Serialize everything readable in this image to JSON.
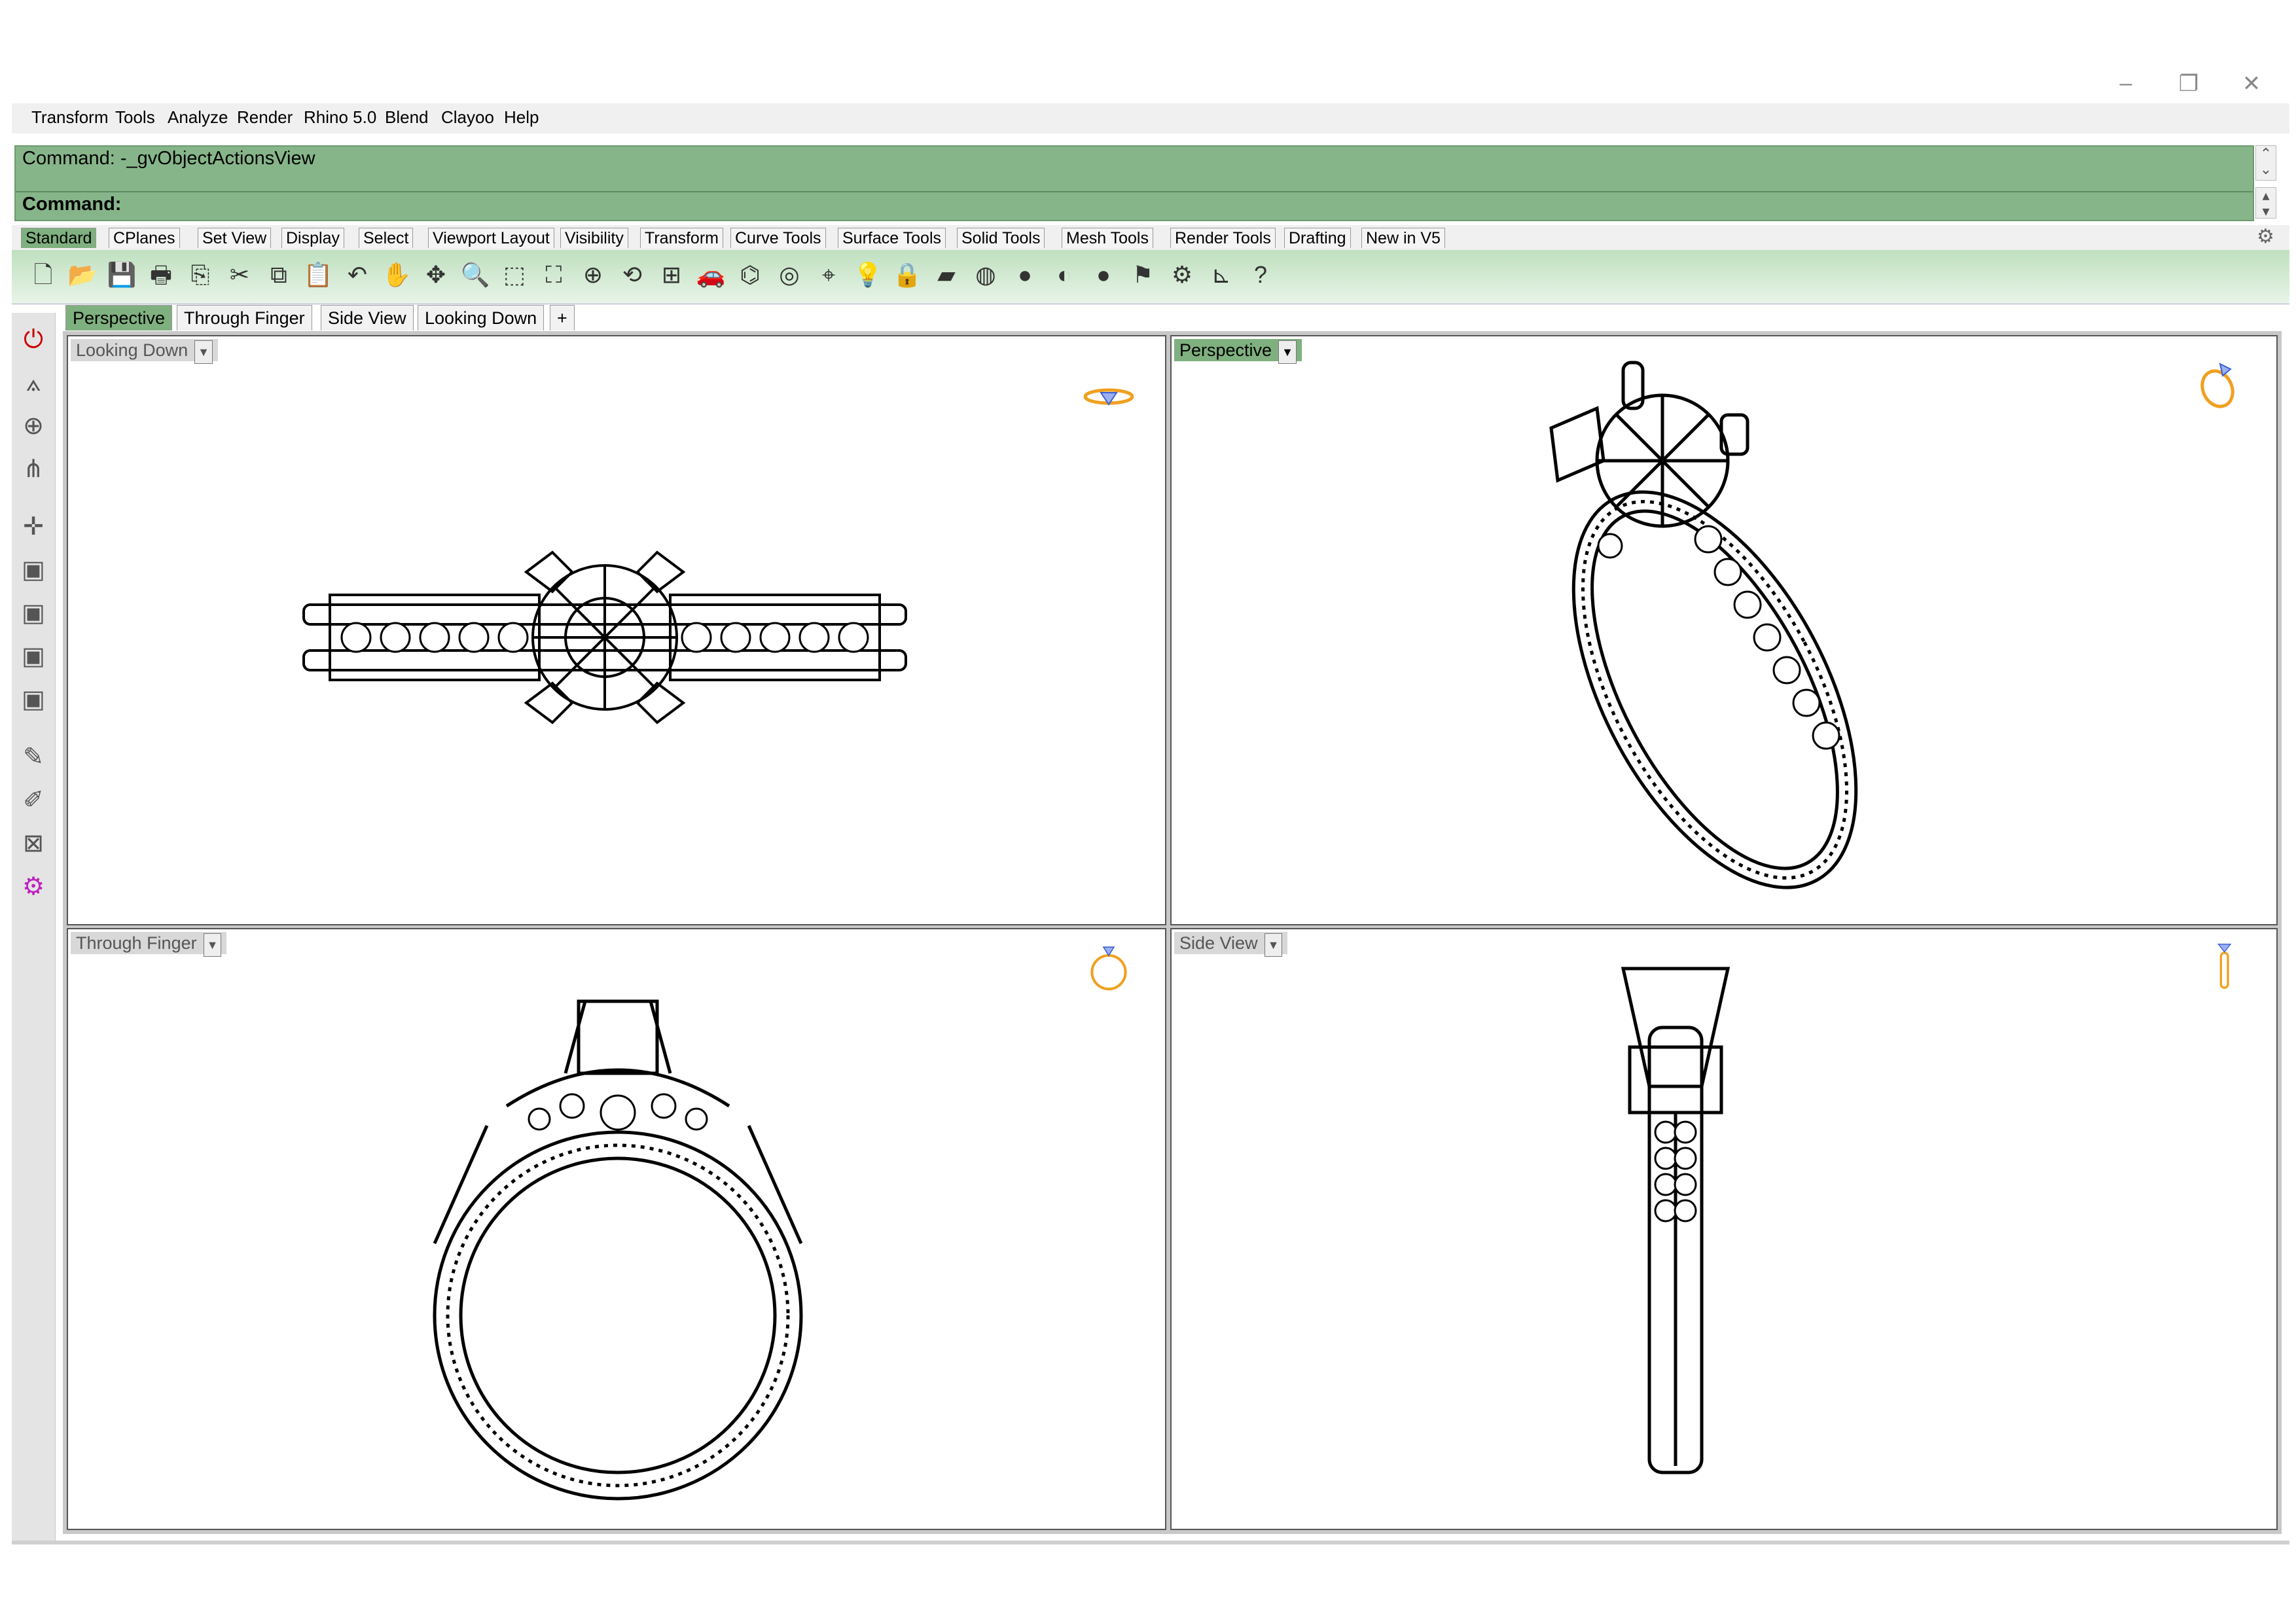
{
  "window": {
    "controls": {
      "minimize": "–",
      "restore": "❐",
      "close": "✕"
    }
  },
  "menubar": {
    "items": [
      "Transform",
      "Tools",
      "Analyze",
      "Render",
      "Rhino 5.0",
      "Blend",
      "Clayoo",
      "Help"
    ]
  },
  "command": {
    "history": "Command: -_gvObjectActionsView",
    "prompt": "Command:"
  },
  "toolbar_tabs": {
    "items": [
      "Standard",
      "CPlanes",
      "Set View",
      "Display",
      "Select",
      "Viewport Layout",
      "Visibility",
      "Transform",
      "Curve Tools",
      "Surface Tools",
      "Solid Tools",
      "Mesh Tools",
      "Render Tools",
      "Drafting",
      "New in V5"
    ],
    "active": "Standard"
  },
  "toolbar": {
    "icons": [
      "new-file-icon",
      "open-file-icon",
      "save-icon",
      "print-icon",
      "import-icon",
      "cut-icon",
      "copy-icon",
      "paste-icon",
      "undo-icon",
      "pan-hand-icon",
      "move-view-icon",
      "zoom-icon",
      "zoom-window-icon",
      "zoom-extents-icon",
      "zoom-selected-icon",
      "rotate-view-icon",
      "four-viewports-icon",
      "car-icon",
      "lamp-icon",
      "circle-icon",
      "snap-icon",
      "bulb-icon",
      "lock-icon",
      "layers-icon",
      "color-wheel-icon",
      "shaded-sphere-icon",
      "rendered-sphere-icon",
      "blue-sphere-icon",
      "flag-icon",
      "gear-settings-icon",
      "dimension-icon",
      "help-icon"
    ],
    "glyphs": [
      "🗋",
      "📂",
      "💾",
      "🖶",
      "⎘",
      "✂",
      "⧉",
      "📋",
      "↶",
      "✋",
      "✥",
      "🔍",
      "⬚",
      "⛶",
      "⊕",
      "⟲",
      "⊞",
      "🚗",
      "⌬",
      "◎",
      "⌖",
      "💡",
      "🔒",
      "▰",
      "◍",
      "●",
      "◐",
      "●",
      "⚑",
      "⚙",
      "⊾",
      "?"
    ]
  },
  "left_tools": {
    "icons": [
      "stop-icon",
      "plane-icon",
      "globe-icon",
      "triangle-nodes-icon",
      "axes-icon",
      "box-icon-1",
      "box-icon-2",
      "box-icon-3",
      "box-icon-4",
      "pen-icon",
      "brush-icon",
      "cancel-box-icon",
      "purple-gear-icon"
    ],
    "glyphs": [
      "⏻",
      "⟑",
      "⊕",
      "⋔",
      "✛",
      "▣",
      "▣",
      "▣",
      "▣",
      "✎",
      "✐",
      "⊠",
      "⚙"
    ]
  },
  "viewport_tabs": {
    "items": [
      "Perspective",
      "Through Finger",
      "Side View",
      "Looking Down"
    ],
    "active": "Perspective",
    "add_label": "+"
  },
  "viewports": [
    {
      "title": "Looking Down",
      "active": false,
      "gumball": "ring-top-gumball-icon"
    },
    {
      "title": "Perspective",
      "active": true,
      "gumball": "ring-perspective-gumball-icon"
    },
    {
      "title": "Through Finger",
      "active": false,
      "gumball": "ring-front-gumball-icon"
    },
    {
      "title": "Side View",
      "active": false,
      "gumball": "ring-side-gumball-icon"
    }
  ],
  "colors": {
    "command_bg": "#87b58a",
    "active_tab": "#7fb07f",
    "gumball_gold": "#f0a020",
    "gumball_blue": "#3a5fd0"
  }
}
